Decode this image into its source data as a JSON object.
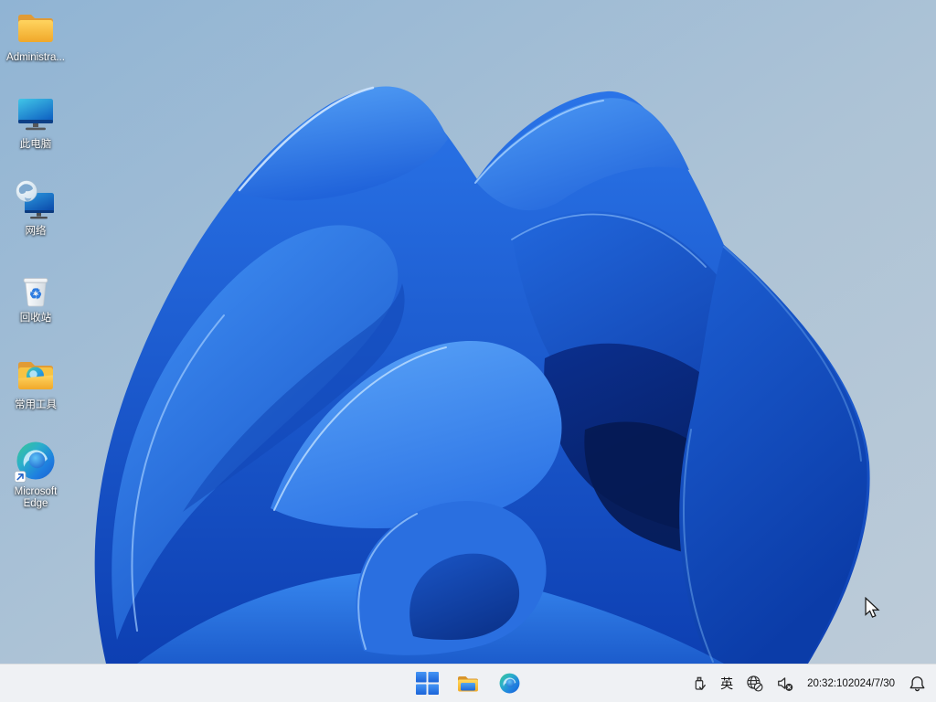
{
  "desktop": {
    "icons": [
      {
        "id": "administrator",
        "label": "Administra..."
      },
      {
        "id": "this-pc",
        "label": "此电脑"
      },
      {
        "id": "network",
        "label": "网络"
      },
      {
        "id": "recycle-bin",
        "label": "回收站"
      },
      {
        "id": "common-tools",
        "label": "常用工具"
      },
      {
        "id": "microsoft-edge",
        "label": "Microsoft Edge"
      }
    ]
  },
  "taskbar": {
    "tray": {
      "ime": "英",
      "clock": {
        "time": "20:32:10",
        "date": "2024/7/30"
      }
    }
  },
  "colors": {
    "accent_blue": "#2f7fe8",
    "taskbar_bg": "#eff1f4",
    "desktop_sky_top": "#93b6d5",
    "desktop_sky_bottom": "#b9c9d6"
  }
}
